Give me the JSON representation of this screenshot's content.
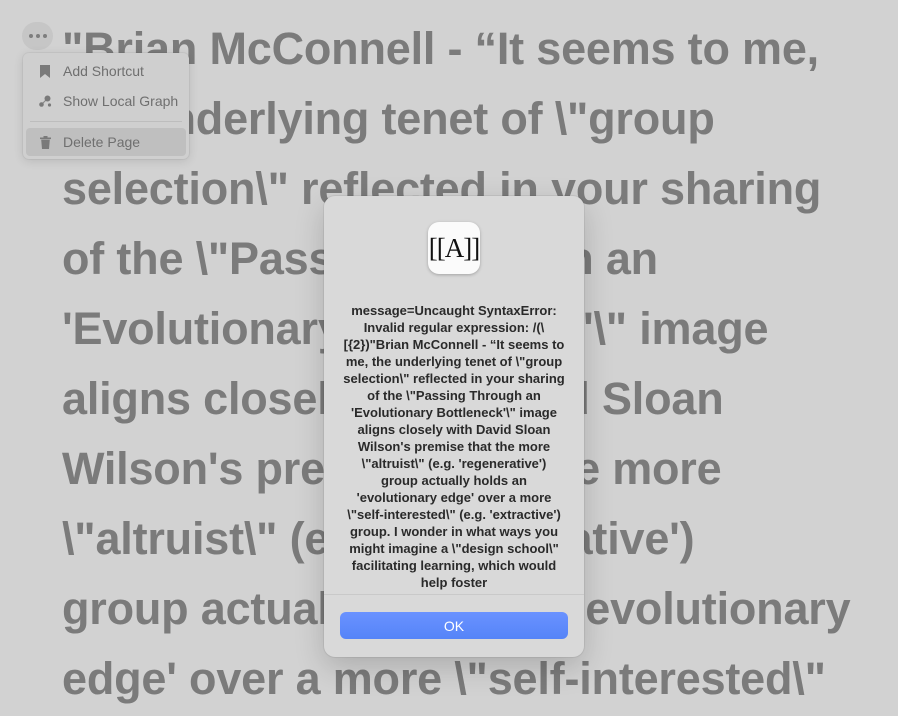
{
  "page": {
    "title_lines": [
      "\"Brian McConnell - “It seems to me,",
      "the underlying tenet of \\\"group",
      "selection\\\" reflected in your sharing",
      "of the \\\"Passing Through an",
      "'Evolutionary Bottleneck'\\\" image",
      "aligns closely with David Sloan",
      "Wilson's premise that the more",
      "\\\"altruist\\\" (e.g. 'regenerative')",
      "group actually holds an 'evolutionary",
      "edge' over a more \\\"self-interested\\\""
    ]
  },
  "page_menu": {
    "items": [
      {
        "label": "Add Shortcut",
        "icon": "bookmark-icon"
      },
      {
        "label": "Show Local Graph",
        "icon": "graph-icon"
      },
      {
        "label": "Delete Page",
        "icon": "trash-icon"
      }
    ]
  },
  "alert": {
    "app_icon_text": "[[A]]",
    "message": "message=Uncaught SyntaxError: Invalid regular expression: /(\\[{2})\"Brian McConnell - “It seems to me, the underlying tenet of \\\"group selection\\\" reflected in your sharing of the \\\"Passing Through an 'Evolutionary Bottleneck'\\\" image aligns closely with David Sloan Wilson's premise that the more \\\"altruist\\\" (e.g. 'regenerative') group actually holds an 'evolutionary edge' over a more \\\"self-interested\\\" (e.g. 'extractive') group. I wonder in what ways you might imagine a \\\"design school\\\" facilitating learning, which would help foster",
    "ok_label": "OK"
  },
  "colors": {
    "accent": "#5a88fa",
    "dimmed_text": "#7b7b7b"
  }
}
